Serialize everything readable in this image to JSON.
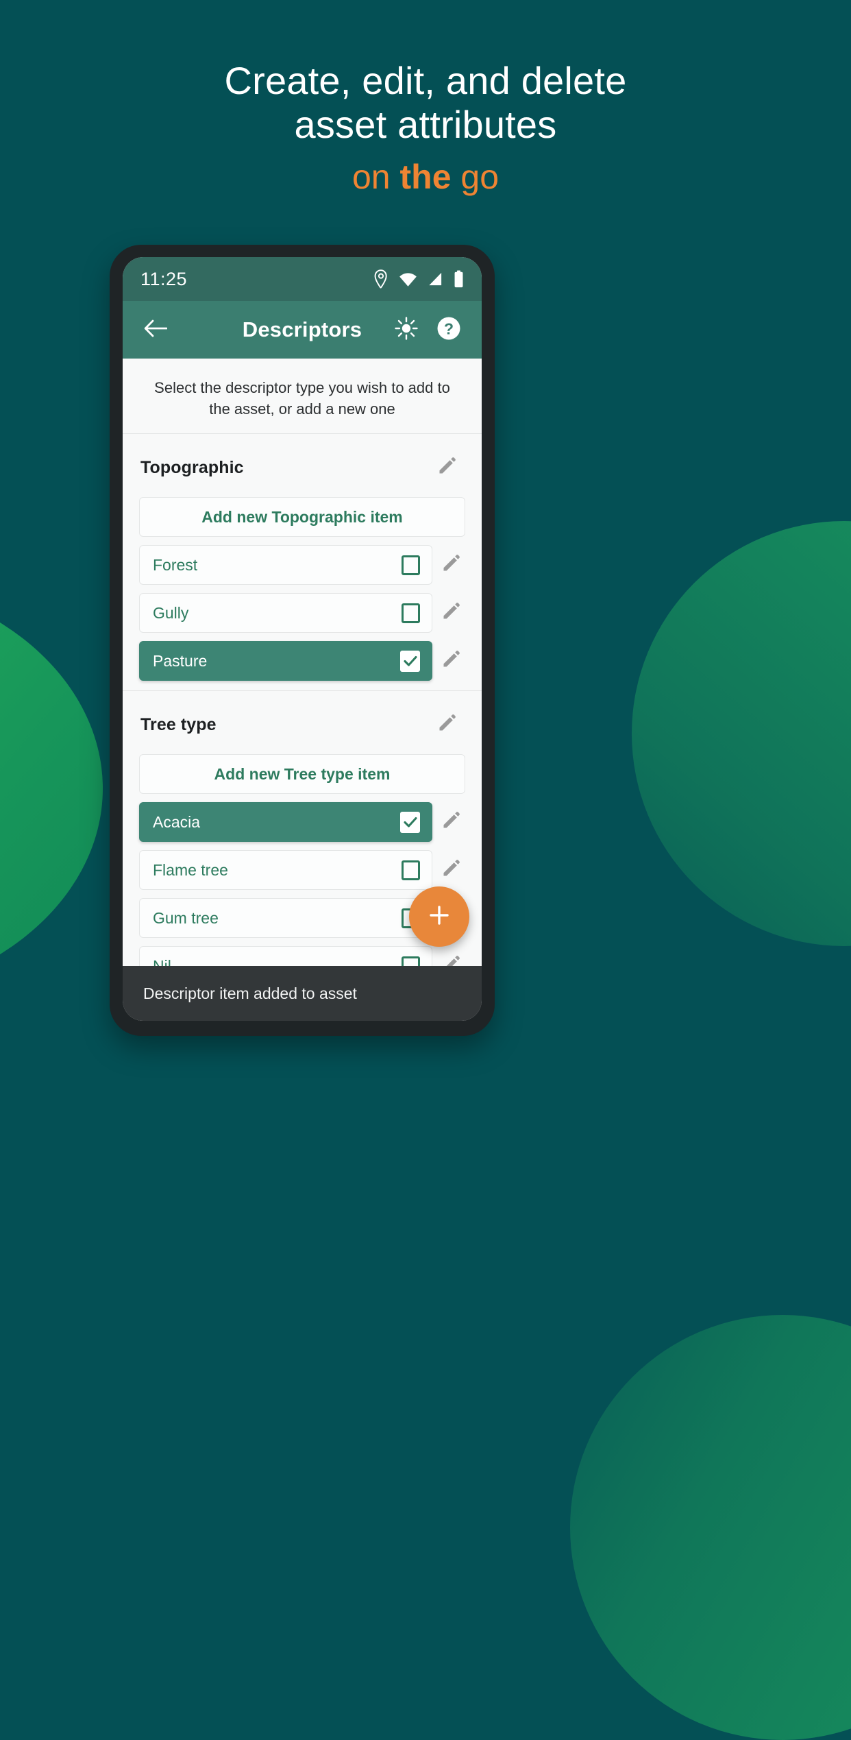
{
  "promo": {
    "line1": "Create, edit, and delete",
    "line2": "asset attributes",
    "accent_pre": "on ",
    "accent_bold": "the",
    "accent_post": " go",
    "accent_color": "#ef8433"
  },
  "phone": {
    "status_bar": {
      "time": "11:25",
      "icons": [
        "location-pin-icon",
        "wifi-icon",
        "signal-icon",
        "battery-icon"
      ]
    },
    "app_bar": {
      "back_icon": "arrow-back-icon",
      "title": "Descriptors",
      "brightness_icon": "brightness-sun-icon",
      "help_icon": "help-circle-icon"
    },
    "intro_text": "Select the descriptor type you wish to add to the asset, or add a new one",
    "groups": [
      {
        "title": "Topographic",
        "edit_icon": "pencil-icon",
        "add_label": "Add new Topographic  item",
        "items": [
          {
            "label": "Forest",
            "selected": false,
            "edit_icon": "pencil-icon"
          },
          {
            "label": "Gully",
            "selected": false,
            "edit_icon": "pencil-icon"
          },
          {
            "label": "Pasture",
            "selected": true,
            "edit_icon": "pencil-icon"
          }
        ]
      },
      {
        "title": "Tree type",
        "edit_icon": "pencil-icon",
        "add_label": "Add new Tree type item",
        "items": [
          {
            "label": "Acacia",
            "selected": true,
            "edit_icon": "pencil-icon"
          },
          {
            "label": "Flame tree",
            "selected": false,
            "edit_icon": "pencil-icon"
          },
          {
            "label": "Gum tree",
            "selected": false,
            "edit_icon": "pencil-icon"
          },
          {
            "label": "Nil",
            "selected": false,
            "edit_icon": "pencil-icon"
          }
        ]
      }
    ],
    "fab": {
      "icon": "plus-icon",
      "color": "#e8873a"
    },
    "snackbar": {
      "message": "Descriptor item added to asset"
    }
  },
  "theme": {
    "background": "#045055",
    "app_bar": "#3b7e70",
    "status_bar": "#336a60",
    "selected_chip": "#3d8574",
    "link_green": "#2d7b5e",
    "accent_orange": "#e8873a"
  }
}
